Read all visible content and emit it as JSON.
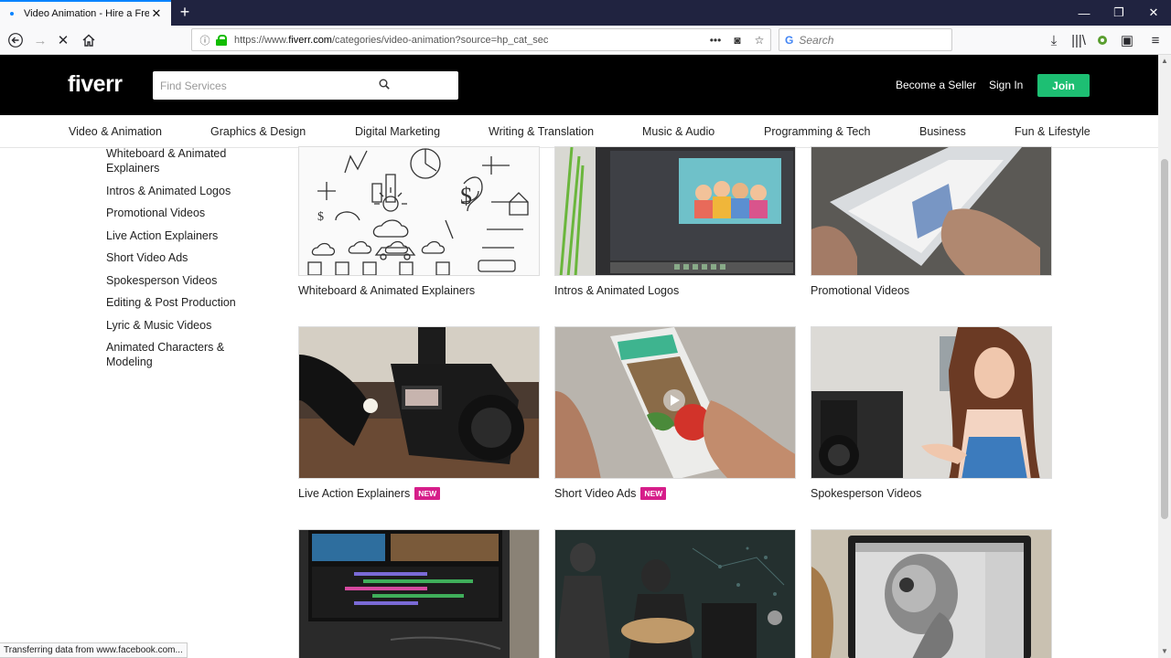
{
  "browser": {
    "tab_title": "Video Animation - Hire a Freelanc",
    "url_prefix": "https://www.",
    "url_domain": "fiverr.com",
    "url_path": "/categories/video-animation?source=hp_cat_sec",
    "search_placeholder": "Search",
    "status_text": "Transferring data from www.facebook.com..."
  },
  "header": {
    "logo": "fiverr",
    "search_placeholder": "Find Services",
    "become_seller": "Become a Seller",
    "sign_in": "Sign In",
    "join": "Join"
  },
  "categories": [
    "Video & Animation",
    "Graphics & Design",
    "Digital Marketing",
    "Writing & Translation",
    "Music & Audio",
    "Programming & Tech",
    "Business",
    "Fun & Lifestyle"
  ],
  "sidebar": [
    "Whiteboard & Animated Explainers",
    "Intros & Animated Logos",
    "Promotional Videos",
    "Live Action Explainers",
    "Short Video Ads",
    "Spokesperson Videos",
    "Editing & Post Production",
    "Lyric & Music Videos",
    "Animated Characters & Modeling"
  ],
  "cards": [
    {
      "label": "Whiteboard & Animated Explainers",
      "badge": ""
    },
    {
      "label": "Intros & Animated Logos",
      "badge": ""
    },
    {
      "label": "Promotional Videos",
      "badge": ""
    },
    {
      "label": "Live Action Explainers",
      "badge": "NEW"
    },
    {
      "label": "Short Video Ads",
      "badge": "NEW"
    },
    {
      "label": "Spokesperson Videos",
      "badge": ""
    },
    {
      "label": "",
      "badge": ""
    },
    {
      "label": "",
      "badge": ""
    },
    {
      "label": "",
      "badge": ""
    }
  ],
  "colors": {
    "brand_green": "#1dbf73",
    "new_badge": "#d61e8a",
    "header_bg": "#000000"
  }
}
